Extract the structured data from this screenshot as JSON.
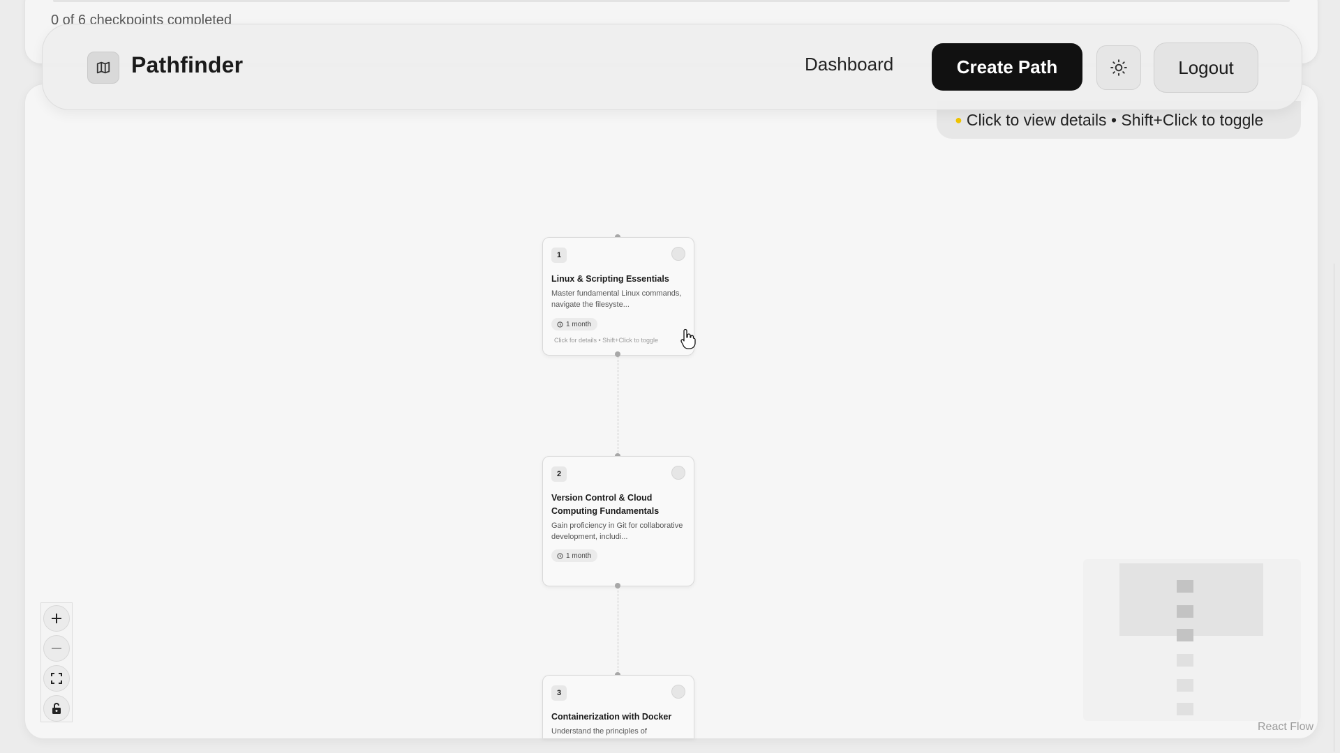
{
  "progress": {
    "text": "0 of 6 checkpoints completed"
  },
  "navbar": {
    "brand": "Pathfinder",
    "brand_icon": "map-icon",
    "dashboard_label": "Dashboard",
    "create_label": "Create Path",
    "theme_icon": "sun-icon",
    "logout_label": "Logout"
  },
  "hint": {
    "icon": "lightbulb-icon",
    "text": "Click to view details • Shift+Click to toggle"
  },
  "nodes": [
    {
      "number": "1",
      "title": "Linux & Scripting Essentials",
      "description": "Master fundamental Linux commands, navigate the filesyste...",
      "duration": "1 month",
      "footer": "Click for details • Shift+Click to toggle"
    },
    {
      "number": "2",
      "title": "Version Control & Cloud Computing Fundamentals",
      "description": "Gain proficiency in Git for collaborative development, includi...",
      "duration": "1 month"
    },
    {
      "number": "3",
      "title": "Containerization with Docker",
      "description": "Understand the principles of"
    }
  ],
  "controls": [
    "zoom-in-icon",
    "zoom-out-icon",
    "fit-view-icon",
    "lock-icon"
  ],
  "attribution": "React Flow",
  "colors": {
    "primary": "#111111",
    "background": "#f6f6f6",
    "accent_bulb": "#f0c400"
  }
}
